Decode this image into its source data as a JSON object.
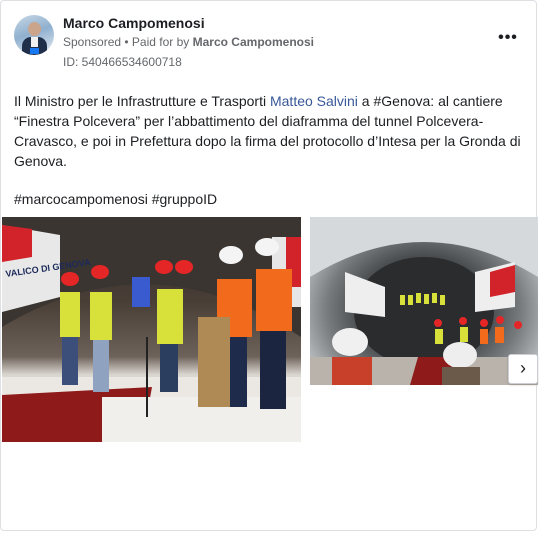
{
  "post": {
    "author": "Marco Campomenosi",
    "sponsored_label": "Sponsored",
    "separator": " • ",
    "paid_for_prefix": "Paid for by ",
    "paid_for_by": "Marco Campomenosi",
    "id_line": "ID: 540466534600718",
    "text_before_link": "Il Ministro per le Infrastrutture e Trasporti ",
    "link_text": "Matteo Salvini",
    "text_after_link": " a #Genova: al cantiere “Finestra Polcevera” per l’abbattimento del diaframma del tunnel Polcevera-Cravasco, e poi in Prefettura dopo la firma del protocollo d’Intesa per la Gronda di Genova.",
    "hashtags": "#marcocampomenosi #gruppoID"
  },
  "icons": {
    "more": "more-options-icon",
    "next": "chevron-right-icon"
  },
  "controls": {
    "more_glyph": "•••",
    "next_glyph": "›"
  },
  "photos": {
    "photo1_banner": "VALICO DI GENOVA"
  },
  "colors": {
    "link": "#385898",
    "secondary_text": "#65676b"
  }
}
